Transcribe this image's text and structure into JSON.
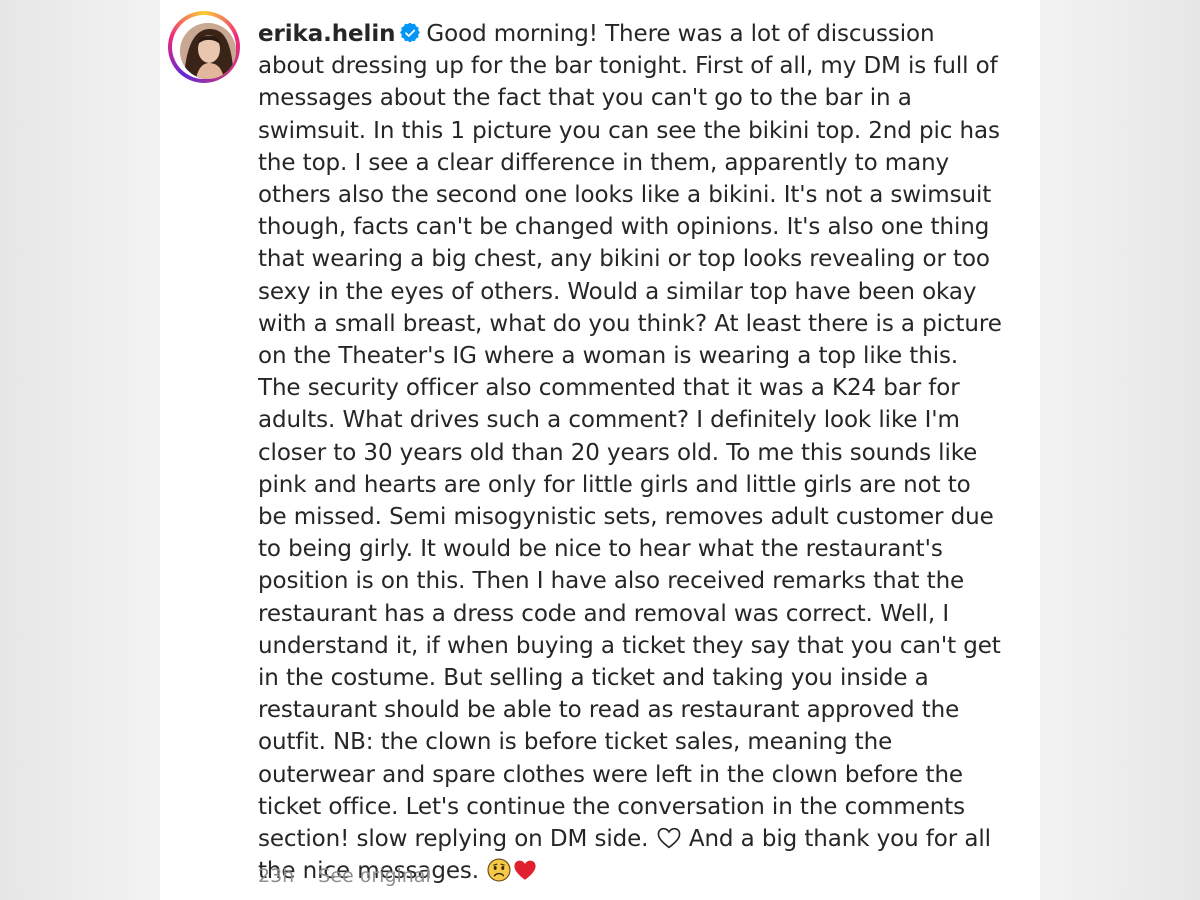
{
  "post": {
    "username": "erika.helin",
    "verified": true,
    "caption_main": "Good morning! There was a lot of discussion about dressing up for the bar tonight. First of all, my DM is full of messages about the fact that you can't go to the bar in a swimsuit. In this 1 picture you can see the bikini top. 2nd pic has the top. I see a clear difference in them, apparently to many others also the second one looks like a bikini. It's not a swimsuit though, facts can't be changed with opinions. It's also one thing that wearing a big chest, any bikini or top looks revealing or too sexy in the eyes of others. Would a similar top have been okay with a small breast, what do you think? At least there is a picture on the Theater's IG where a woman is wearing a top like this. The security officer also commented that it was a K24 bar for adults. What drives such a comment? I definitely look like I'm closer to 30 years old than 20 years old. To me this sounds like pink and hearts are only for little girls and little girls are not to be missed. Semi misogynistic sets, removes adult customer due to being girly. It would be nice to hear what the restaurant's position is on this. Then I have also received remarks that the restaurant has a dress code and removal was correct. Well, I understand it, if when buying a ticket they say that you can't get in the costume. But selling a ticket and taking you inside a restaurant should be able to read as restaurant approved the outfit. NB: the clown is before ticket sales, meaning the outerwear and spare clothes were left in the clown before the ticket office. Let's continue the conversation in the comments section! slow replying on DM side.",
    "caption_mid": "And a big thank you for all the nice messages.",
    "emojis": [
      "white-heart-icon",
      "sad-face-icon",
      "red-heart-icon"
    ],
    "timestamp": "23h",
    "see_original_label": "See original"
  },
  "colors": {
    "verified_badge": "#0095f6",
    "text": "#262626",
    "meta_text": "#8e8e8e",
    "red_heart": "#e0202e"
  }
}
